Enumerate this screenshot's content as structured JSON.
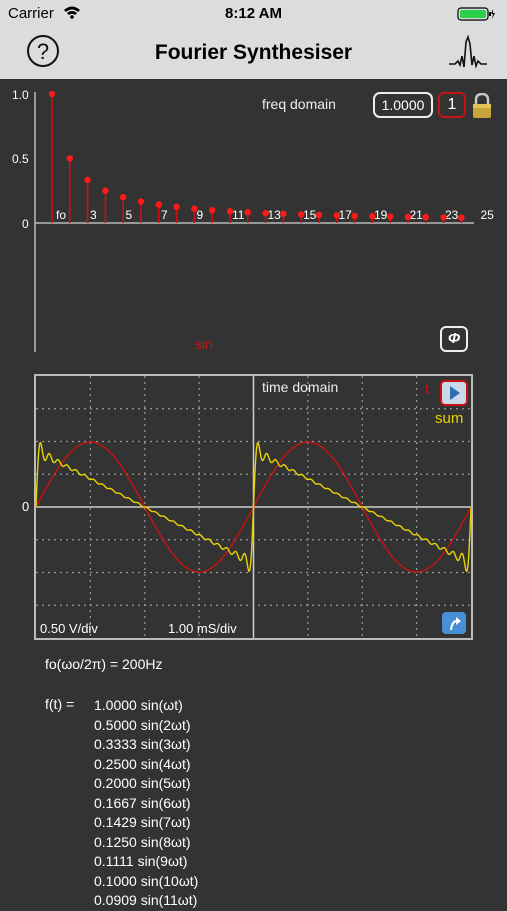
{
  "status_bar": {
    "carrier": "Carrier",
    "time": "8:12 AM"
  },
  "nav": {
    "title": "Fourier Synthesiser",
    "help_label": "?"
  },
  "freq_domain": {
    "label": "freq domain",
    "amplitude_value": "1.0000",
    "selected_harmonic": "1",
    "phase_label": "Φ",
    "waveform_label": "sin",
    "y_ticks": [
      "1.0",
      "0.5",
      "0"
    ],
    "x_ticks": [
      "fo",
      "3",
      "5",
      "7",
      "9",
      "11",
      "13",
      "15",
      "17",
      "19",
      "21",
      "23",
      "25"
    ],
    "harmonic_amplitudes": [
      1.0,
      0.5,
      0.3333,
      0.25,
      0.2,
      0.1667,
      0.1429,
      0.125,
      0.1111,
      0.1,
      0.0909,
      0.0833,
      0.0769,
      0.0714,
      0.0667,
      0.0625,
      0.0588,
      0.0556,
      0.0526,
      0.05,
      0.0476,
      0.0455,
      0.0435,
      0.0417
    ]
  },
  "time_domain": {
    "label": "time domain",
    "t_label": "t",
    "sum_label": "sum",
    "zero_label": "0",
    "volts_per_div": "0.50 V/div",
    "time_per_div": "1.00 mS/div"
  },
  "colors": {
    "accent_red": "#cc1111",
    "sum_yellow": "#e6d400",
    "background": "#333333"
  },
  "fundamental": "fo(ωo/2π) = 200Hz",
  "series": {
    "prefix": "f(t)  =",
    "terms": [
      "1.0000 sin(ωt)",
      "0.5000 sin(2ωt)",
      "0.3333 sin(3ωt)",
      "0.2500 sin(4ωt)",
      "0.2000 sin(5ωt)",
      "0.1667 sin(6ωt)",
      "0.1429 sin(7ωt)",
      "0.1250 sin(8ωt)",
      "0.1111 sin(9ωt)",
      "0.1000 sin(10ωt)",
      "0.0909 sin(11ωt)"
    ]
  },
  "icons": {
    "wifi": "wifi-icon",
    "battery": "battery-icon",
    "help": "question-icon",
    "waveform": "waveform-icon",
    "lock": "lock-icon",
    "play": "play-icon",
    "reset": "reset-icon"
  }
}
